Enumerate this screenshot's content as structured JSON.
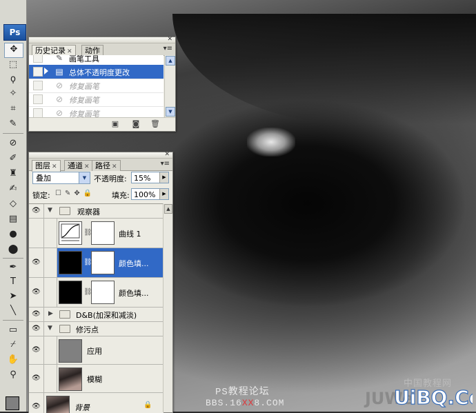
{
  "watermark": {
    "forum": "PS教程论坛",
    "url_prefix": "BBS.16",
    "url_red": "XX",
    "url_suffix": "8.COM",
    "logo_cn": "中国教程网",
    "logo": "UiBQ.CoM",
    "logo_left": "JUWe"
  },
  "toolbox": {
    "logo": "Ps"
  },
  "history": {
    "tabs": [
      {
        "label": "历史记录"
      },
      {
        "label": "动作"
      }
    ],
    "rows": [
      {
        "label": "画笔工具",
        "icon": "brush-icon"
      },
      {
        "label": "总体不透明度更改",
        "icon": "history-state-icon"
      },
      {
        "label": "修复画笔",
        "icon": "healing-brush-icon"
      },
      {
        "label": "修复画笔",
        "icon": "healing-brush-icon"
      },
      {
        "label": "修复画笔",
        "icon": "healing-brush-icon"
      }
    ]
  },
  "layers": {
    "tabs": [
      {
        "label": "图层"
      },
      {
        "label": "通道"
      },
      {
        "label": "路径"
      }
    ],
    "blend_mode": "叠加",
    "opacity_label": "不透明度:",
    "opacity_value": "15%",
    "lock_label": "锁定:",
    "fill_label": "填充:",
    "fill_value": "100%",
    "items": [
      {
        "name": "观察器"
      },
      {
        "name": "曲线 1"
      },
      {
        "name": "颜色填..."
      },
      {
        "name": "颜色填..."
      },
      {
        "name": "D&B(加深和减淡)"
      },
      {
        "name": "修污点"
      },
      {
        "name": "应用"
      },
      {
        "name": "模糊"
      },
      {
        "name": "背景"
      }
    ]
  },
  "colors": {
    "selection": "#3169c6",
    "panel_bg": "#ecebe3"
  }
}
